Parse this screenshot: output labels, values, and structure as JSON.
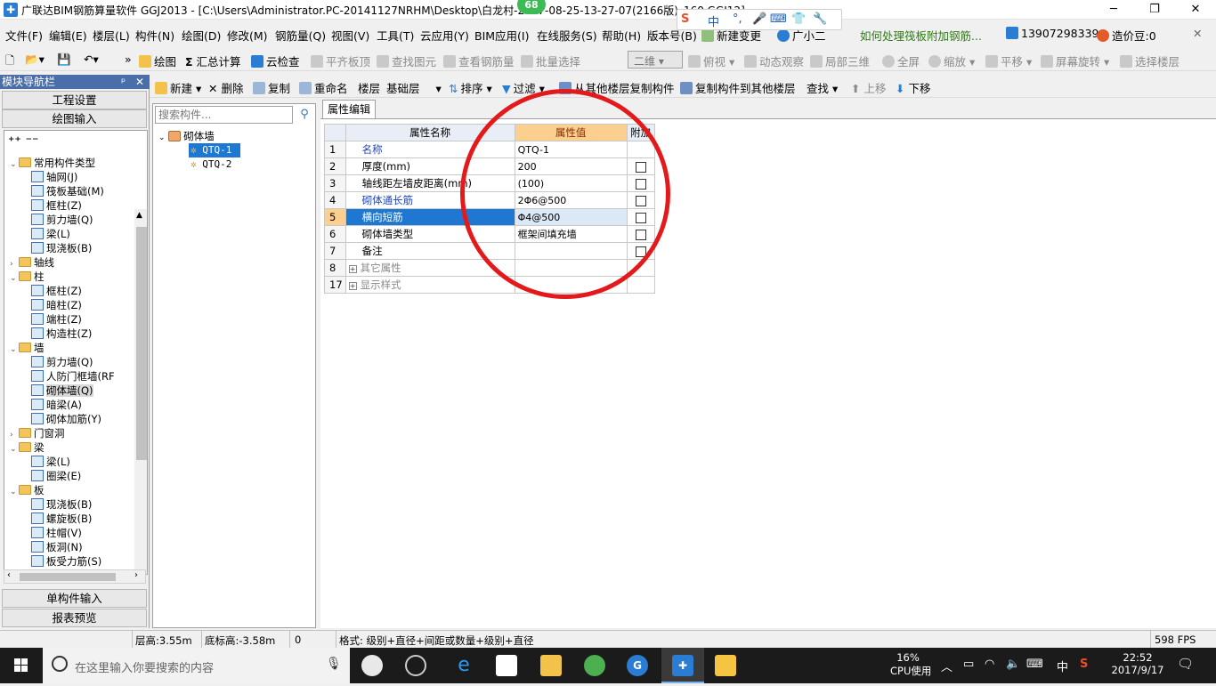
{
  "window": {
    "title": "广联达BIM钢筋算量软件 GGJ2013 - [C:\\Users\\Administrator.PC-20141127NRHM\\Desktop\\白龙村-2017-08-25-13-27-07(2166版)_160.GGJ12]",
    "badge": "68",
    "minimize": "─",
    "restore": "❐",
    "close": "✕"
  },
  "ime": {
    "logo": "S",
    "mode": "中",
    "punct": "°,",
    "mic": "🎤",
    "keyboard": "⌨",
    "skin": "👕",
    "tools": "🔧"
  },
  "menubar": {
    "items": [
      "文件(F)",
      "编辑(E)",
      "楼层(L)",
      "构件(N)",
      "绘图(D)",
      "修改(M)",
      "钢筋量(Q)",
      "视图(V)",
      "工具(T)",
      "云应用(Y)",
      "BIM应用(I)",
      "在线服务(S)",
      "帮助(H)",
      "版本号(B)"
    ],
    "new_change": "新建变更",
    "guangxiaoer": "广小二",
    "tip": "如何处理筏板附加钢筋...",
    "phone": "13907298339",
    "price_beans": "造价豆:0"
  },
  "toolbar1": {
    "draw": "绘图",
    "summary": "汇总计算",
    "cloud_check": "云检查",
    "align_slab": "平齐板顶",
    "find_element": "查找图元",
    "view_rebar": "查看钢筋量",
    "batch_select": "批量选择",
    "view_mode": "二维",
    "top_view": "俯视",
    "dynamic_view": "动态观察",
    "local_3d": "局部三维",
    "fullscreen": "全屏",
    "zoom": "缩放",
    "pan": "平移",
    "rotate": "屏幕旋转",
    "select_floor": "选择楼层"
  },
  "toolbar2": {
    "new": "新建",
    "delete": "删除",
    "copy": "复制",
    "rename": "重命名",
    "floor_label": "楼层",
    "floor_value": "基础层",
    "sort": "排序",
    "filter": "过滤",
    "copy_from_floor": "从其他楼层复制构件",
    "copy_to_floor": "复制构件到其他楼层",
    "find": "查找",
    "move_up": "上移",
    "move_down": "下移"
  },
  "nav": {
    "title": "模块导航栏",
    "pin": "ᵖ",
    "close": "✕",
    "project_settings": "工程设置",
    "draw_input": "绘图输入",
    "single_input": "单构件输入",
    "report_preview": "报表预览",
    "tree": [
      {
        "label": "常用构件类型",
        "level": 0,
        "type": "folder",
        "exp": "⌄"
      },
      {
        "label": "轴网(J)",
        "level": 1,
        "type": "item"
      },
      {
        "label": "筏板基础(M)",
        "level": 1,
        "type": "item"
      },
      {
        "label": "框柱(Z)",
        "level": 1,
        "type": "item"
      },
      {
        "label": "剪力墙(Q)",
        "level": 1,
        "type": "item"
      },
      {
        "label": "梁(L)",
        "level": 1,
        "type": "item"
      },
      {
        "label": "现浇板(B)",
        "level": 1,
        "type": "item"
      },
      {
        "label": "轴线",
        "level": 0,
        "type": "folder",
        "exp": "›"
      },
      {
        "label": "柱",
        "level": 0,
        "type": "folder",
        "exp": "⌄"
      },
      {
        "label": "框柱(Z)",
        "level": 1,
        "type": "item"
      },
      {
        "label": "暗柱(Z)",
        "level": 1,
        "type": "item"
      },
      {
        "label": "端柱(Z)",
        "level": 1,
        "type": "item"
      },
      {
        "label": "构造柱(Z)",
        "level": 1,
        "type": "item"
      },
      {
        "label": "墙",
        "level": 0,
        "type": "folder",
        "exp": "⌄"
      },
      {
        "label": "剪力墙(Q)",
        "level": 1,
        "type": "item"
      },
      {
        "label": "人防门框墙(RF",
        "level": 1,
        "type": "item"
      },
      {
        "label": "砌体墙(Q)",
        "level": 1,
        "type": "item",
        "selected": true
      },
      {
        "label": "暗梁(A)",
        "level": 1,
        "type": "item"
      },
      {
        "label": "砌体加筋(Y)",
        "level": 1,
        "type": "item"
      },
      {
        "label": "门窗洞",
        "level": 0,
        "type": "folder",
        "exp": "›"
      },
      {
        "label": "梁",
        "level": 0,
        "type": "folder",
        "exp": "⌄"
      },
      {
        "label": "梁(L)",
        "level": 1,
        "type": "item"
      },
      {
        "label": "圈梁(E)",
        "level": 1,
        "type": "item"
      },
      {
        "label": "板",
        "level": 0,
        "type": "folder",
        "exp": "⌄"
      },
      {
        "label": "现浇板(B)",
        "level": 1,
        "type": "item"
      },
      {
        "label": "螺旋板(B)",
        "level": 1,
        "type": "item"
      },
      {
        "label": "柱帽(V)",
        "level": 1,
        "type": "item"
      },
      {
        "label": "板洞(N)",
        "level": 1,
        "type": "item"
      },
      {
        "label": "板受力筋(S)",
        "level": 1,
        "type": "item"
      }
    ]
  },
  "components": {
    "search_placeholder": "搜索构件...",
    "root": "砌体墙",
    "items": [
      "QTQ-1",
      "QTQ-2"
    ]
  },
  "props": {
    "tab": "属性编辑",
    "col_name": "属性名称",
    "col_value": "属性值",
    "col_extra": "附加",
    "rows": [
      {
        "num": "1",
        "name": "名称",
        "value": "QTQ-1",
        "style": "blue",
        "check": false
      },
      {
        "num": "2",
        "name": "厚度(mm)",
        "value": "200",
        "style": "",
        "check": true
      },
      {
        "num": "3",
        "name": "轴线距左墙皮距离(mm)",
        "value": "(100)",
        "style": "",
        "check": true
      },
      {
        "num": "4",
        "name": "砌体通长筋",
        "value": "2Φ6@500",
        "style": "blue",
        "check": true
      },
      {
        "num": "5",
        "name": "横向短筋",
        "value": "Φ4@500",
        "style": "blue",
        "check": true,
        "selected": true
      },
      {
        "num": "6",
        "name": "砌体墙类型",
        "value": "框架间填充墙",
        "style": "",
        "check": true
      },
      {
        "num": "7",
        "name": "备注",
        "value": "",
        "style": "",
        "check": true
      },
      {
        "num": "8",
        "name": "其它属性",
        "value": "",
        "style": "grey",
        "check": false,
        "expandable": true
      },
      {
        "num": "17",
        "name": "显示样式",
        "value": "",
        "style": "grey",
        "check": false,
        "expandable": true
      }
    ]
  },
  "status": {
    "floor_height": "层高:3.55m",
    "base_height": "底标高:-3.58m",
    "value": "0",
    "format": "格式: 级别+直径+间距或数量+级别+直径",
    "fps": "598 FPS"
  },
  "taskbar": {
    "search_placeholder": "在这里输入你要搜索的内容",
    "cpu_percent": "16%",
    "cpu_label": "CPU使用",
    "lang": "中",
    "time": "22:52",
    "date": "2017/9/17"
  }
}
